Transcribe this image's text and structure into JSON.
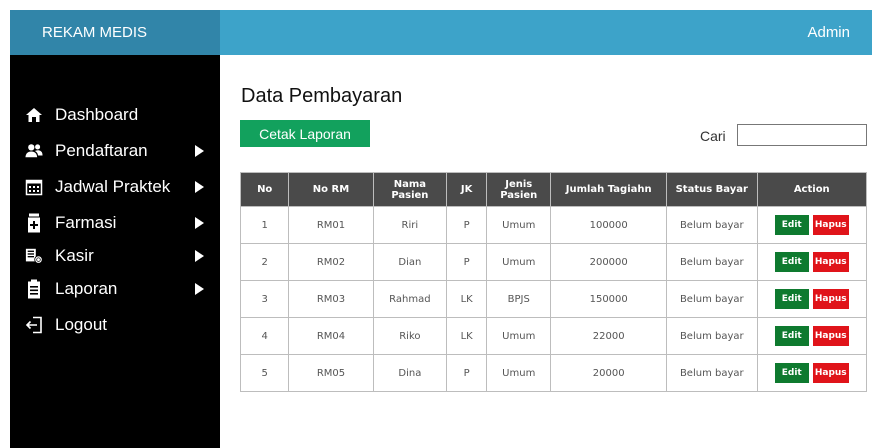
{
  "header": {
    "brand": "REKAM MEDIS",
    "user": "Admin"
  },
  "sidebar": {
    "items": [
      {
        "label": "Dashboard",
        "icon": "home-icon",
        "submenu": false
      },
      {
        "label": "Pendaftaran",
        "icon": "users-icon",
        "submenu": true
      },
      {
        "label": "Jadwal Praktek",
        "icon": "calendar-icon",
        "submenu": true
      },
      {
        "label": "Farmasi",
        "icon": "medicine-icon",
        "submenu": true
      },
      {
        "label": "Kasir",
        "icon": "cashier-icon",
        "submenu": true
      },
      {
        "label": "Laporan",
        "icon": "clipboard-icon",
        "submenu": true
      },
      {
        "label": "Logout",
        "icon": "logout-icon",
        "submenu": false
      }
    ]
  },
  "main": {
    "title": "Data Pembayaran",
    "print_button": "Cetak Laporan",
    "search_label": "Cari",
    "search_value": ""
  },
  "table": {
    "headers": [
      "No",
      "No RM",
      "Nama Pasien",
      "JK",
      "Jenis Pasien",
      "Jumlah Tagiahn",
      "Status Bayar",
      "Action"
    ],
    "rows": [
      {
        "no": "1",
        "rm": "RM01",
        "nama": "Riri",
        "jk": "P",
        "jenis": "Umum",
        "jumlah": "100000",
        "status": "Belum bayar"
      },
      {
        "no": "2",
        "rm": "RM02",
        "nama": "Dian",
        "jk": "P",
        "jenis": "Umum",
        "jumlah": "200000",
        "status": "Belum bayar"
      },
      {
        "no": "3",
        "rm": "RM03",
        "nama": "Rahmad",
        "jk": "LK",
        "jenis": "BPJS",
        "jumlah": "150000",
        "status": "Belum bayar"
      },
      {
        "no": "4",
        "rm": "RM04",
        "nama": "Riko",
        "jk": "LK",
        "jenis": "Umum",
        "jumlah": "22000",
        "status": "Belum bayar"
      },
      {
        "no": "5",
        "rm": "RM05",
        "nama": "Dina",
        "jk": "P",
        "jenis": "Umum",
        "jumlah": "20000",
        "status": "Belum bayar"
      }
    ],
    "edit_label": "Edit",
    "delete_label": "Hapus"
  },
  "colors": {
    "topbar": "#3da3c9",
    "brand_bg": "#3185a9",
    "sidebar": "#000000",
    "print_button": "#12a15d",
    "table_header": "#4a4a4a",
    "edit_button": "#0e7a2f",
    "delete_button": "#e0141a"
  }
}
